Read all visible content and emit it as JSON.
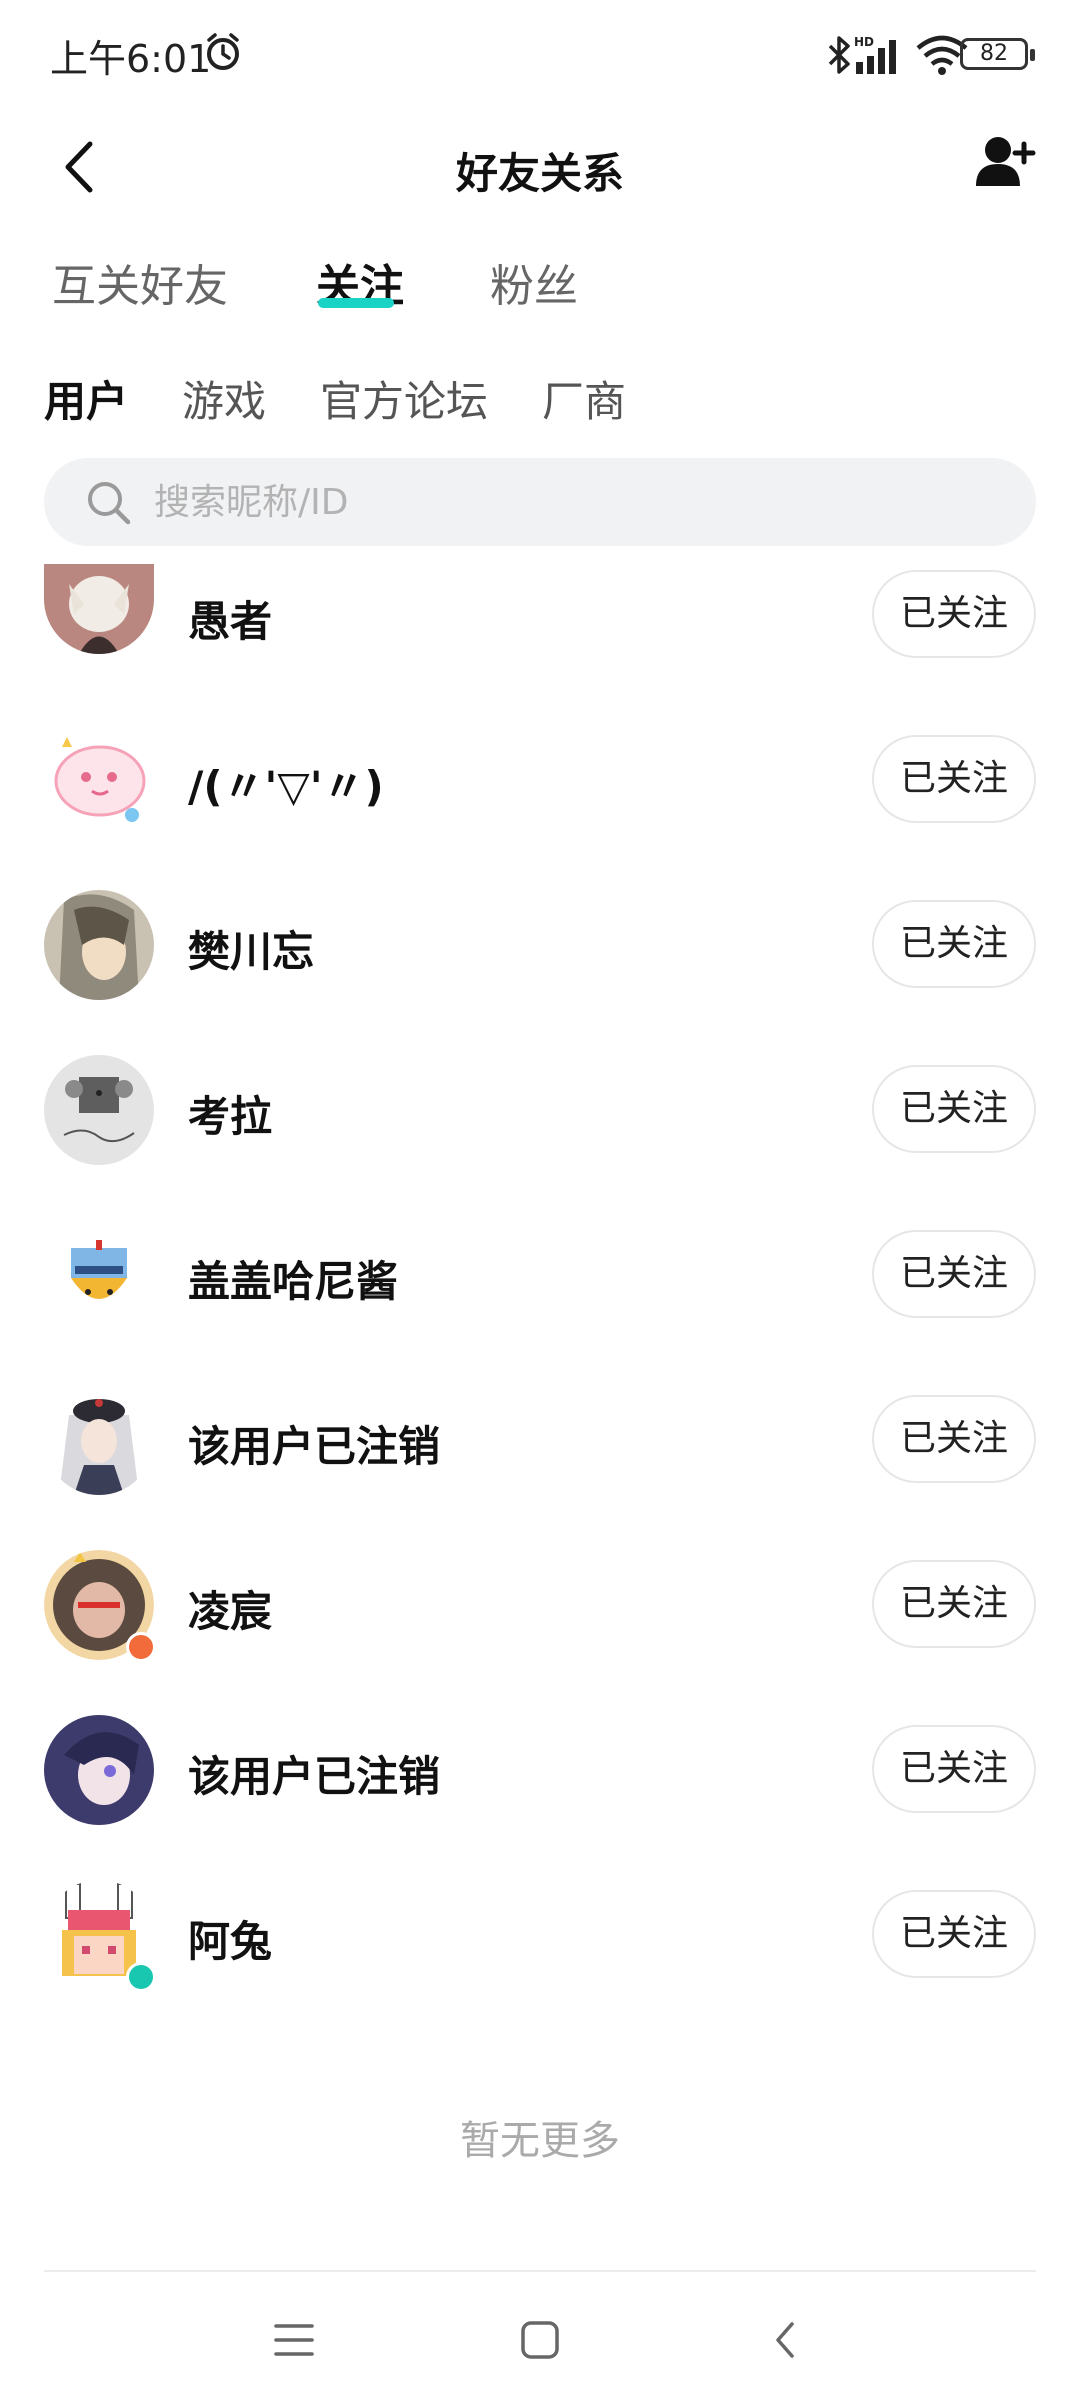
{
  "status_bar": {
    "time": "上午6:01",
    "battery": "82"
  },
  "header": {
    "title": "好友关系"
  },
  "tabs": [
    {
      "label": "互关好友",
      "active": false
    },
    {
      "label": "关注",
      "active": true
    },
    {
      "label": "粉丝",
      "active": false
    }
  ],
  "subtabs": [
    {
      "label": "用户",
      "active": true
    },
    {
      "label": "游戏",
      "active": false
    },
    {
      "label": "官方论坛",
      "active": false
    },
    {
      "label": "厂商",
      "active": false
    }
  ],
  "search": {
    "placeholder": "搜索昵称/ID"
  },
  "users": [
    {
      "name": "愚者",
      "button": "已关注",
      "avatar_color": "#b9877f"
    },
    {
      "name": "/(〃'▽'〃)",
      "button": "已关注",
      "avatar_color": "#f6b6c8"
    },
    {
      "name": "樊川忘",
      "button": "已关注",
      "avatar_color": "#8f8a7c"
    },
    {
      "name": "考拉",
      "button": "已关注",
      "avatar_color": "#e4e4e4"
    },
    {
      "name": "盖盖哈尼酱",
      "button": "已关注",
      "avatar_color": "#f2b632"
    },
    {
      "name": "该用户已注销",
      "button": "已关注",
      "avatar_color": "#3a3f57"
    },
    {
      "name": "凌宸",
      "button": "已关注",
      "avatar_color": "#5a4a3f",
      "badge_color": "#f26b3a"
    },
    {
      "name": "该用户已注销",
      "button": "已关注",
      "avatar_color": "#3d3b6b"
    },
    {
      "name": "阿兔",
      "button": "已关注",
      "avatar_color": "#f06a8a",
      "badge_color": "#19c7b0"
    }
  ],
  "footer": {
    "no_more": "暂无更多"
  },
  "colors": {
    "accent": "#19d3c5"
  }
}
